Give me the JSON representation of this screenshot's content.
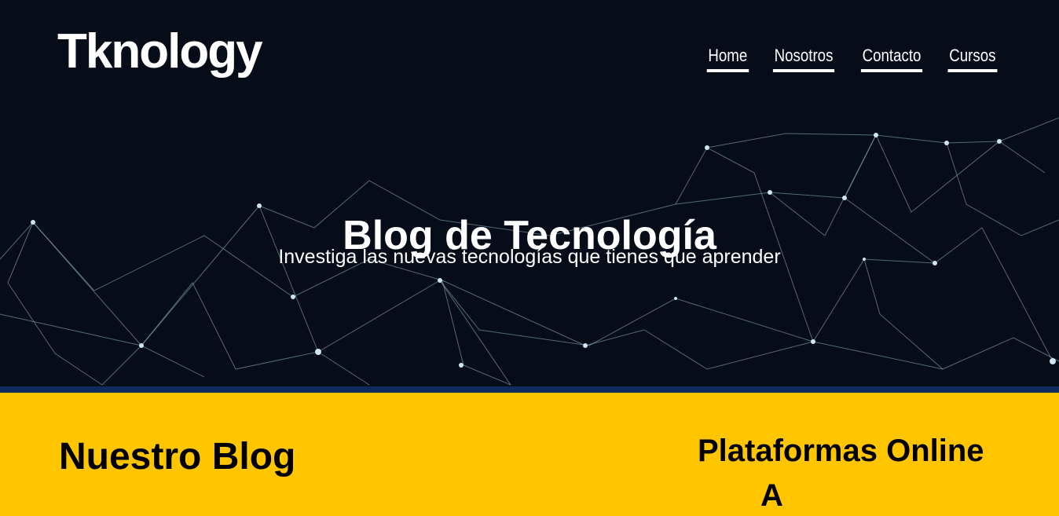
{
  "brand": {
    "logo_text": "Tknology"
  },
  "nav": {
    "items": [
      {
        "label": "Home"
      },
      {
        "label": "Nosotros"
      },
      {
        "label": "Contacto"
      },
      {
        "label": "Cursos"
      }
    ]
  },
  "hero": {
    "title": "Blog de Tecnología",
    "subtitle": "Investiga las nuevas tecnologías que tienes que aprender"
  },
  "main": {
    "section_title": "Nuestro Blog"
  },
  "aside": {
    "title": "Plataformas Online",
    "next_heading_partial": "A"
  },
  "colors": {
    "hero_bg": "#070d18",
    "hero_border": "#0f2a5c",
    "content_bg": "#ffc600",
    "network_line": "#8fb4c8"
  }
}
